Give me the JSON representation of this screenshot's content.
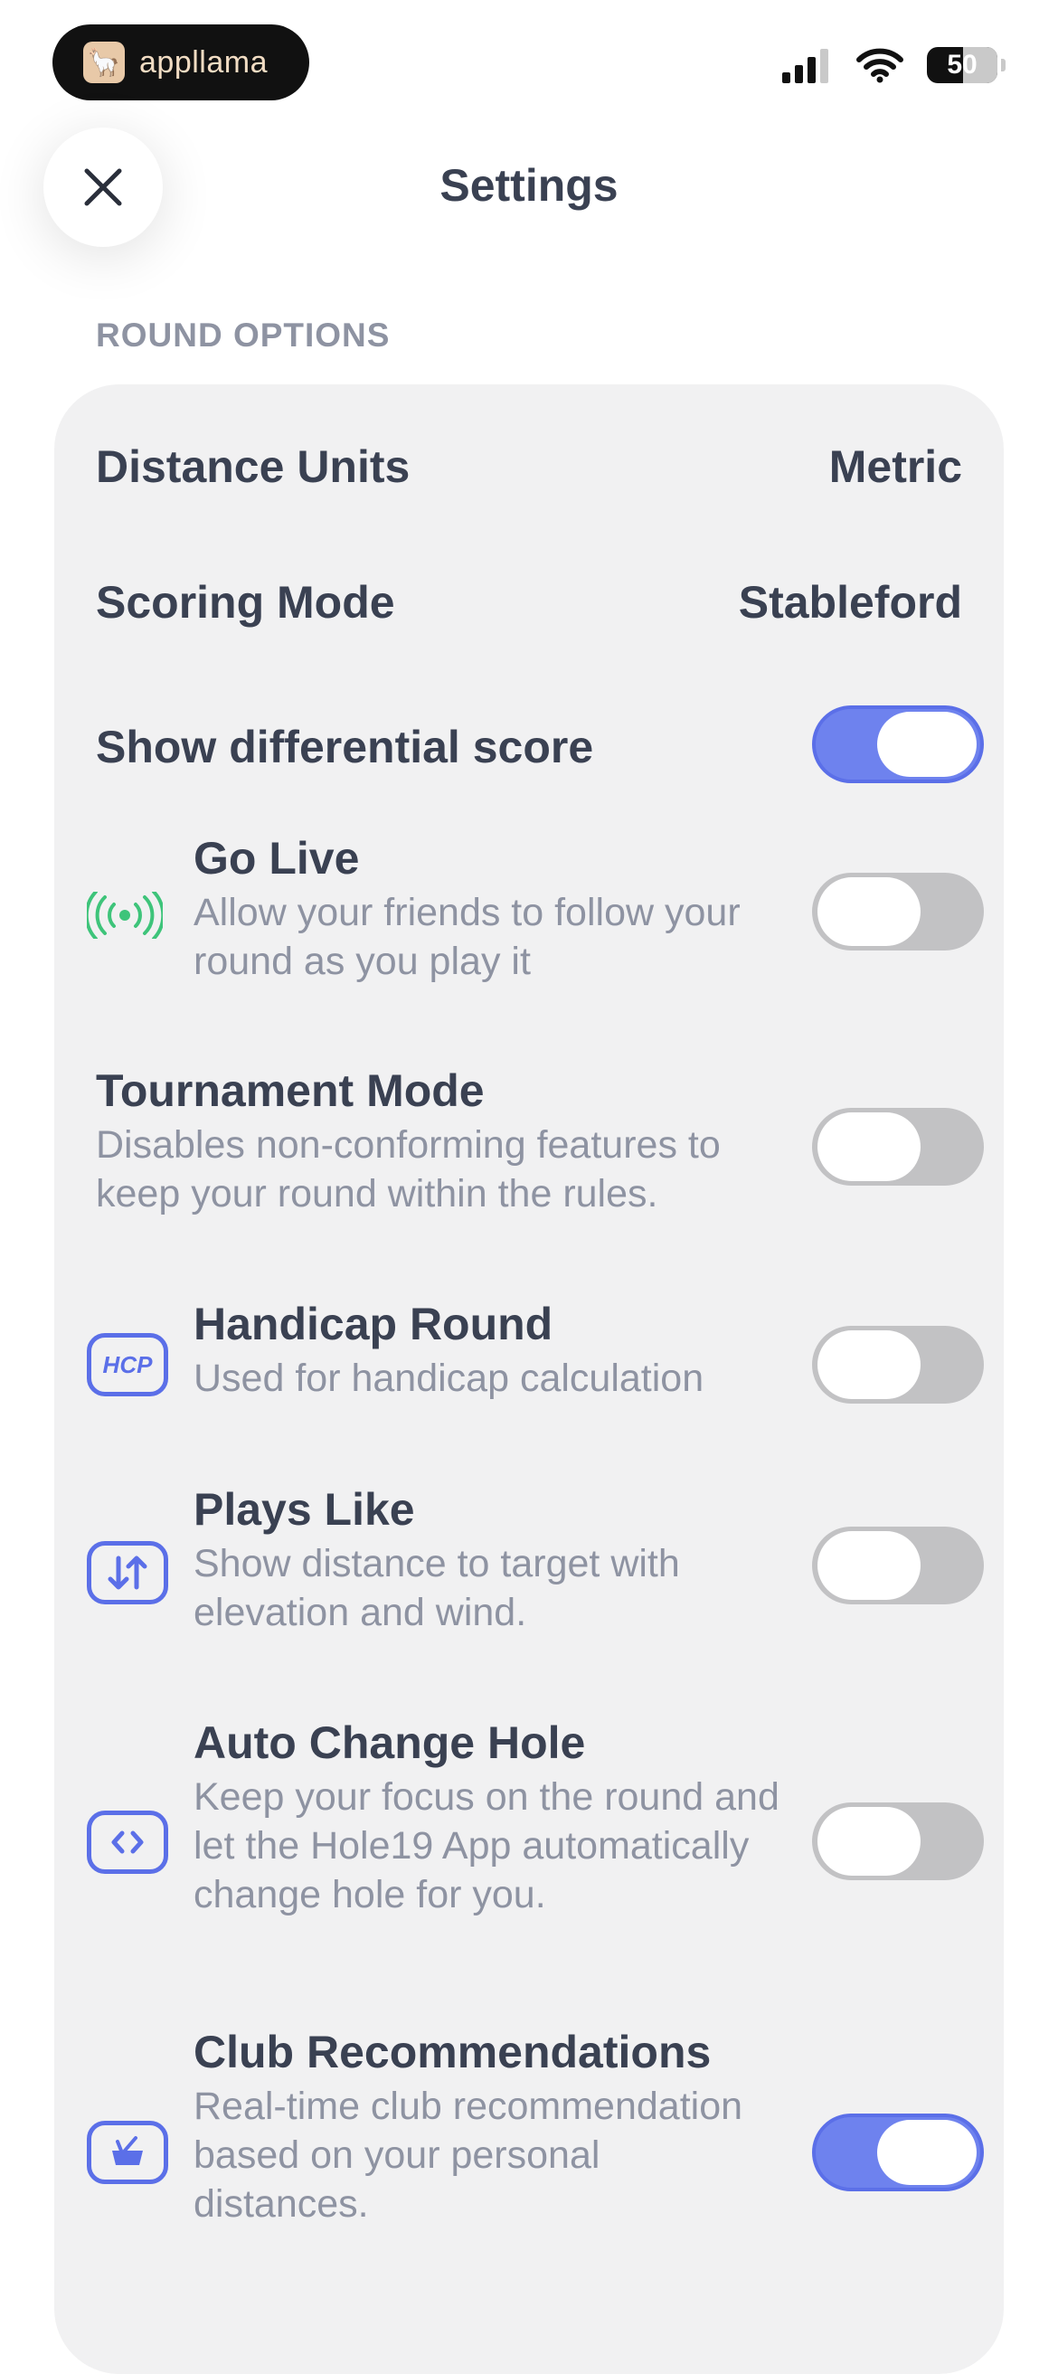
{
  "status_bar": {
    "brand": "appllama",
    "battery": "50"
  },
  "header": {
    "title": "Settings",
    "close_icon": "close-icon"
  },
  "section": {
    "title": "ROUND OPTIONS"
  },
  "settings": {
    "distance_units": {
      "label": "Distance Units",
      "value": "Metric"
    },
    "scoring_mode": {
      "label": "Scoring Mode",
      "value": "Stableford"
    },
    "differential": {
      "label": "Show differential score",
      "on": true
    },
    "go_live": {
      "label": "Go Live",
      "desc": "Allow your friends to follow your round as you play it",
      "icon": "broadcast-icon",
      "on": false
    },
    "tournament": {
      "label": "Tournament Mode",
      "desc": "Disables non-conforming features to keep your round within the rules.",
      "on": false
    },
    "handicap": {
      "label": "Handicap Round",
      "desc": "Used for handicap calculation",
      "icon_text": "HCP",
      "on": false
    },
    "plays_like": {
      "label": "Plays Like",
      "desc": "Show distance to target with elevation and wind.",
      "icon": "elevation-arrows-icon",
      "on": false
    },
    "auto_change": {
      "label": "Auto Change Hole",
      "desc": "Keep your focus on the round and let the Hole19 App automatically change hole for you.",
      "icon": "code-arrows-icon",
      "on": false
    },
    "club_rec": {
      "label": "Club Recommendations",
      "desc": "Real-time club recommendation based on your personal distances.",
      "icon": "club-bag-icon",
      "on": true
    }
  },
  "colors": {
    "accent": "#5b6fe8",
    "live_green": "#3ec47a",
    "text_primary": "#3a4152",
    "text_secondary": "#8e93a2",
    "card_bg": "#f1f1f2"
  }
}
